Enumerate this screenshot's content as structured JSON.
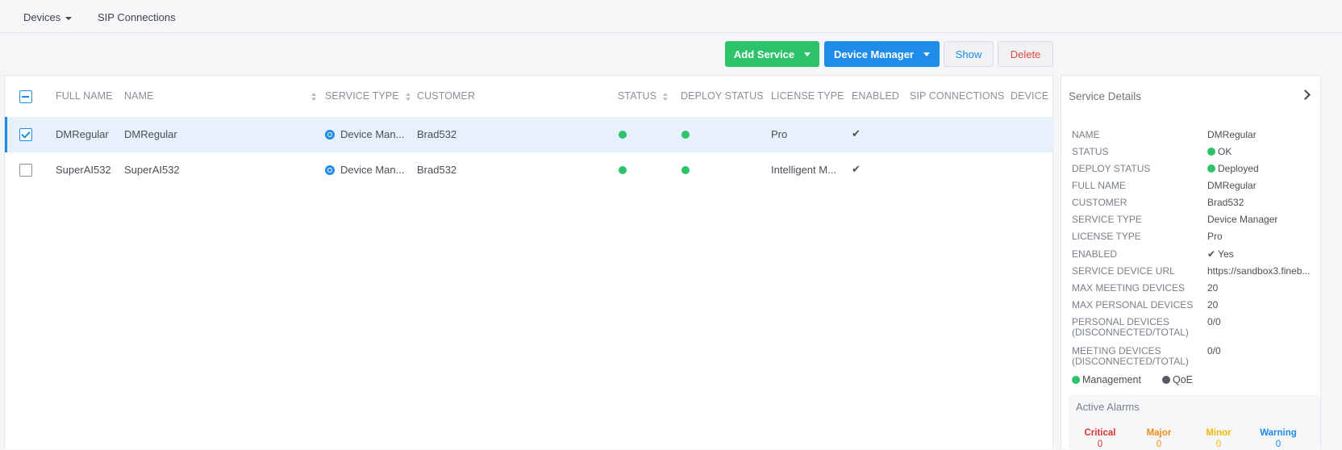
{
  "topnav": {
    "devices": "Devices",
    "sip_connections": "SIP Connections"
  },
  "toolbar": {
    "add_service": "Add Service",
    "device_manager": "Device Manager",
    "show": "Show",
    "delete": "Delete"
  },
  "colors": {
    "green": "#2cc36b",
    "blue": "#1f8cea",
    "danger_text": "#e04a45",
    "critical": "#e0322f",
    "major": "#f08c16",
    "minor": "#f2b705",
    "warning": "#1f8cea"
  },
  "table": {
    "columns": [
      "FULL NAME",
      "NAME",
      "SERVICE TYPE",
      "CUSTOMER",
      "STATUS",
      "DEPLOY STATUS",
      "LICENSE TYPE",
      "ENABLED",
      "SIP CONNECTIONS",
      "DEVICE"
    ],
    "rows": [
      {
        "full_name": "DMRegular",
        "name": "DMRegular",
        "service_type": "Device Man...",
        "customer": "Brad532",
        "status": "ok",
        "deploy_status": "deployed",
        "license_type": "Pro",
        "enabled": "✔",
        "selected": true
      },
      {
        "full_name": "SuperAI532",
        "name": "SuperAI532",
        "service_type": "Device Man...",
        "customer": "Brad532",
        "status": "ok",
        "deploy_status": "deployed",
        "license_type": "Intelligent M...",
        "enabled": "✔",
        "selected": false
      }
    ]
  },
  "details": {
    "title": "Service Details",
    "fields": [
      {
        "label": "NAME",
        "value": "DMRegular"
      },
      {
        "label": "STATUS",
        "value": "OK"
      },
      {
        "label": "DEPLOY STATUS",
        "value": "Deployed"
      },
      {
        "label": "FULL NAME",
        "value": "DMRegular"
      },
      {
        "label": "CUSTOMER",
        "value": "Brad532"
      },
      {
        "label": "SERVICE TYPE",
        "value": "Device Manager"
      },
      {
        "label": "LICENSE TYPE",
        "value": "Pro"
      },
      {
        "label": "ENABLED",
        "value": "✔ Yes"
      },
      {
        "label": "SERVICE DEVICE URL",
        "value": "https://sandbox3.fineb..."
      },
      {
        "label": "MAX MEETING DEVICES",
        "value": "20"
      },
      {
        "label": "MAX PERSONAL DEVICES",
        "value": "20"
      },
      {
        "label": "PERSONAL DEVICES (DISCONNECTED/TOTAL)",
        "value": "0/0"
      },
      {
        "label": "MEETING DEVICES (DISCONNECTED/TOTAL)",
        "value": "0/0"
      }
    ],
    "legend": {
      "management": "Management",
      "qoe": "QoE"
    },
    "alarms": {
      "title": "Active Alarms",
      "critical_label": "Critical",
      "critical_value": "0",
      "major_label": "Major",
      "major_value": "0",
      "minor_label": "Minor",
      "minor_value": "0",
      "warning_label": "Warning",
      "warning_value": "0"
    }
  }
}
